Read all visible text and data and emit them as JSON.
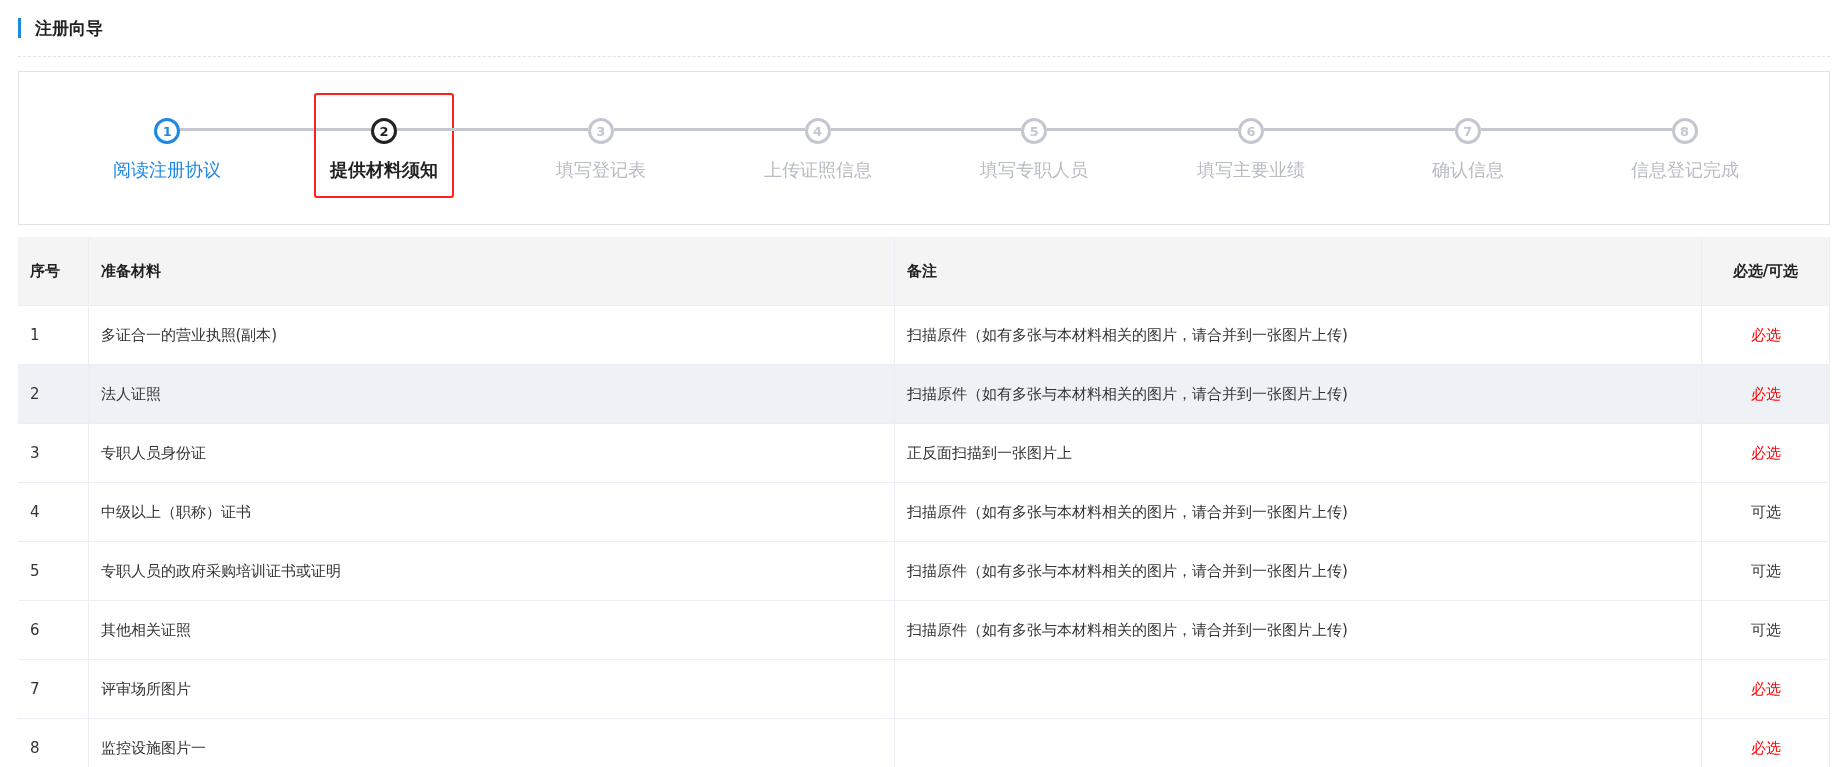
{
  "page_title": "注册向导",
  "steps": [
    {
      "number": "1",
      "label": "阅读注册协议",
      "completed": true,
      "selected": false,
      "outlined": false
    },
    {
      "number": "2",
      "label": "提供材料须知",
      "completed": false,
      "selected": true,
      "outlined": true
    },
    {
      "number": "3",
      "label": "填写登记表",
      "completed": false,
      "selected": false,
      "outlined": false
    },
    {
      "number": "4",
      "label": "上传证照信息",
      "completed": false,
      "selected": false,
      "outlined": false
    },
    {
      "number": "5",
      "label": "填写专职人员",
      "completed": false,
      "selected": false,
      "outlined": false
    },
    {
      "number": "6",
      "label": "填写主要业绩",
      "completed": false,
      "selected": false,
      "outlined": false
    },
    {
      "number": "7",
      "label": "确认信息",
      "completed": false,
      "selected": false,
      "outlined": false
    },
    {
      "number": "8",
      "label": "信息登记完成",
      "completed": false,
      "selected": false,
      "outlined": false
    }
  ],
  "table": {
    "columns": [
      "序号",
      "准备材料",
      "备注",
      "必选/可选"
    ],
    "rows": [
      {
        "index": "1",
        "material": "多证合一的营业执照(副本)",
        "note": "扫描原件（如有多张与本材料相关的图片，请合并到一张图片上传)",
        "requirement": "必选",
        "required": true,
        "highlighted": false
      },
      {
        "index": "2",
        "material": "法人证照",
        "note": "扫描原件（如有多张与本材料相关的图片，请合并到一张图片上传)",
        "requirement": "必选",
        "required": true,
        "highlighted": true
      },
      {
        "index": "3",
        "material": "专职人员身份证",
        "note": "正反面扫描到一张图片上",
        "requirement": "必选",
        "required": true,
        "highlighted": false
      },
      {
        "index": "4",
        "material": "中级以上（职称）证书",
        "note": "扫描原件（如有多张与本材料相关的图片，请合并到一张图片上传)",
        "requirement": "可选",
        "required": false,
        "highlighted": false
      },
      {
        "index": "5",
        "material": "专职人员的政府采购培训证书或证明",
        "note": "扫描原件（如有多张与本材料相关的图片，请合并到一张图片上传)",
        "requirement": "可选",
        "required": false,
        "highlighted": false
      },
      {
        "index": "6",
        "material": "其他相关证照",
        "note": "扫描原件（如有多张与本材料相关的图片，请合并到一张图片上传)",
        "requirement": "可选",
        "required": false,
        "highlighted": false
      },
      {
        "index": "7",
        "material": "评审场所图片",
        "requirement": "必选",
        "required": true,
        "highlighted": false
      },
      {
        "index": "8",
        "material": "监控设施图片一",
        "requirement": "必选",
        "required": true,
        "highlighted": false
      }
    ]
  }
}
